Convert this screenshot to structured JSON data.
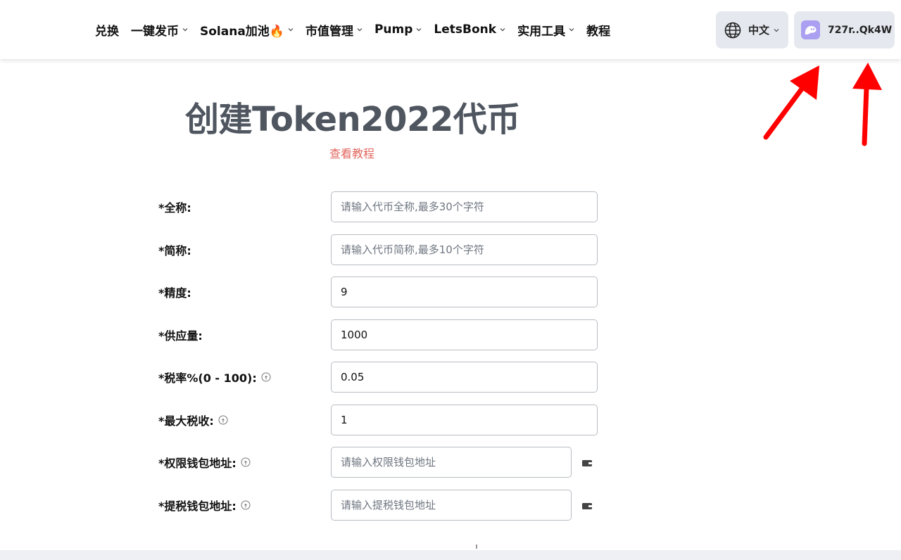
{
  "nav": {
    "items": [
      {
        "label": "兑换",
        "dropdown": false
      },
      {
        "label": "一键发币",
        "dropdown": true
      },
      {
        "label": "Solana加池🔥",
        "dropdown": true
      },
      {
        "label": "市值管理",
        "dropdown": true
      },
      {
        "label": "Pump",
        "dropdown": true
      },
      {
        "label": "LetsBonk",
        "dropdown": true
      },
      {
        "label": "实用工具",
        "dropdown": true
      },
      {
        "label": "教程",
        "dropdown": false
      }
    ]
  },
  "language": {
    "label": "中文",
    "icon": "globe-icon"
  },
  "wallet": {
    "address": "727r..Qk4W",
    "icon": "phantom-ghost-icon",
    "accent": "#ab9ff2"
  },
  "page": {
    "title": "创建Token2022代币",
    "tutorial_link": "查看教程"
  },
  "form": {
    "name": {
      "label": "*全称:",
      "value": "",
      "placeholder": "请输入代币全称,最多30个字符"
    },
    "symbol": {
      "label": "*简称:",
      "value": "",
      "placeholder": "请输入代币简称,最多10个字符"
    },
    "decimals": {
      "label": "*精度:",
      "value": "9",
      "placeholder": ""
    },
    "supply": {
      "label": "*供应量:",
      "value": "1000",
      "placeholder": ""
    },
    "tax_rate": {
      "label": "*税率%(0 - 100):",
      "value": "0.05",
      "placeholder": ""
    },
    "max_tax": {
      "label": "*最大税收:",
      "value": "1",
      "placeholder": ""
    },
    "authority_wallet": {
      "label": "*权限钱包地址:",
      "value": "",
      "placeholder": "请输入权限钱包地址"
    },
    "withdraw_wallet": {
      "label": "*提税钱包地址:",
      "value": "",
      "placeholder": "请输入提税钱包地址"
    }
  },
  "colors": {
    "title": "#4f5660",
    "link": "#e2665e",
    "annotation_arrow": "#ff0000",
    "button_bg": "#e5e9ef"
  }
}
